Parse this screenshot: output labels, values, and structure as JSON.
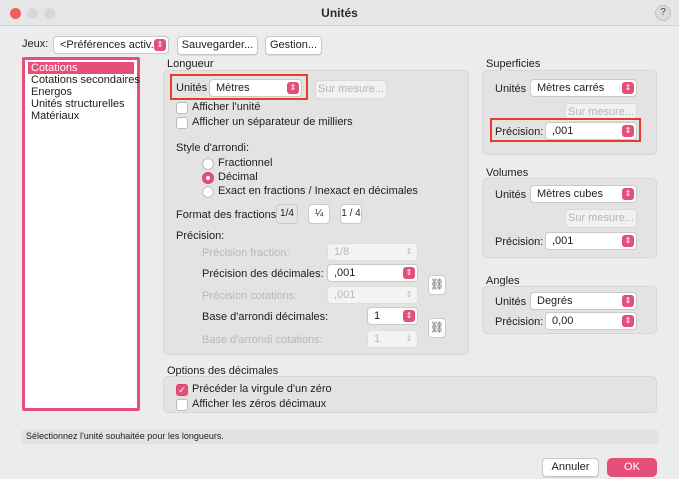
{
  "window": {
    "title": "Unités",
    "help": "?"
  },
  "top": {
    "jeux_label": "Jeux:",
    "jeux_value": "<Préférences activ...",
    "save_label": "Sauvegarder...",
    "manage_label": "Gestion..."
  },
  "sidebar": {
    "items": [
      {
        "label": "Cotations"
      },
      {
        "label": "Cotations secondaires"
      },
      {
        "label": "Energos"
      },
      {
        "label": "Unités structurelles"
      },
      {
        "label": "Matériaux"
      }
    ]
  },
  "longueur": {
    "header": "Longueur",
    "units_label": "Unités",
    "units_value": "Mètres",
    "custom_label": "Sur mesure...",
    "show_unit_label": "Afficher l'unité",
    "show_unit_checked": false,
    "thousands_label": "Afficher un séparateur de milliers",
    "thousands_checked": false,
    "rounding_header": "Style d'arrondi:",
    "radio_fraction": "Fractionnel",
    "radio_decimal": "Décimal",
    "radio_exact": "Exact en fractions / Inexact en décimales",
    "rounding_selected": "Décimal",
    "fraction_format_label": "Format des fractions:",
    "fraction_formats": [
      "1/4",
      "¼",
      "1 / 4"
    ],
    "precision_header": "Précision:",
    "prec_fraction_label": "Précision fraction:",
    "prec_fraction_value": "1/8",
    "prec_decimal_label": "Précision des décimales:",
    "prec_decimal_value": ",001",
    "prec_cotations_label": "Précision cotations:",
    "prec_cotations_value": ",001",
    "base_decimal_label": "Base d'arrondi décimales:",
    "base_decimal_value": "1",
    "base_cotations_label": "Base d'arrondi cotations:",
    "base_cotations_value": "1"
  },
  "decimals": {
    "header": "Options des décimales",
    "leading_zero_label": "Précéder la virgule d'un zéro",
    "leading_zero_checked": true,
    "trailing_zero_label": "Afficher les zéros décimaux",
    "trailing_zero_checked": false
  },
  "superficies": {
    "header": "Superficies",
    "units_label": "Unités",
    "units_value": "Mètres carrés",
    "custom_label": "Sur mesure...",
    "precision_label": "Précision:",
    "precision_value": ",001"
  },
  "volumes": {
    "header": "Volumes",
    "units_label": "Unités",
    "units_value": "Mètres cubes",
    "custom_label": "Sur mesure...",
    "precision_label": "Précision:",
    "precision_value": ",001"
  },
  "angles": {
    "header": "Angles",
    "units_label": "Unités",
    "units_value": "Degrés",
    "precision_label": "Précision:",
    "precision_value": "0,00"
  },
  "status": {
    "text": "Sélectionnez l'unité souhaitée pour les longueurs."
  },
  "footer": {
    "cancel_label": "Annuler",
    "ok_label": "OK"
  },
  "colors": {
    "accent": "#e5507a",
    "highlight": "#e63b2e"
  }
}
